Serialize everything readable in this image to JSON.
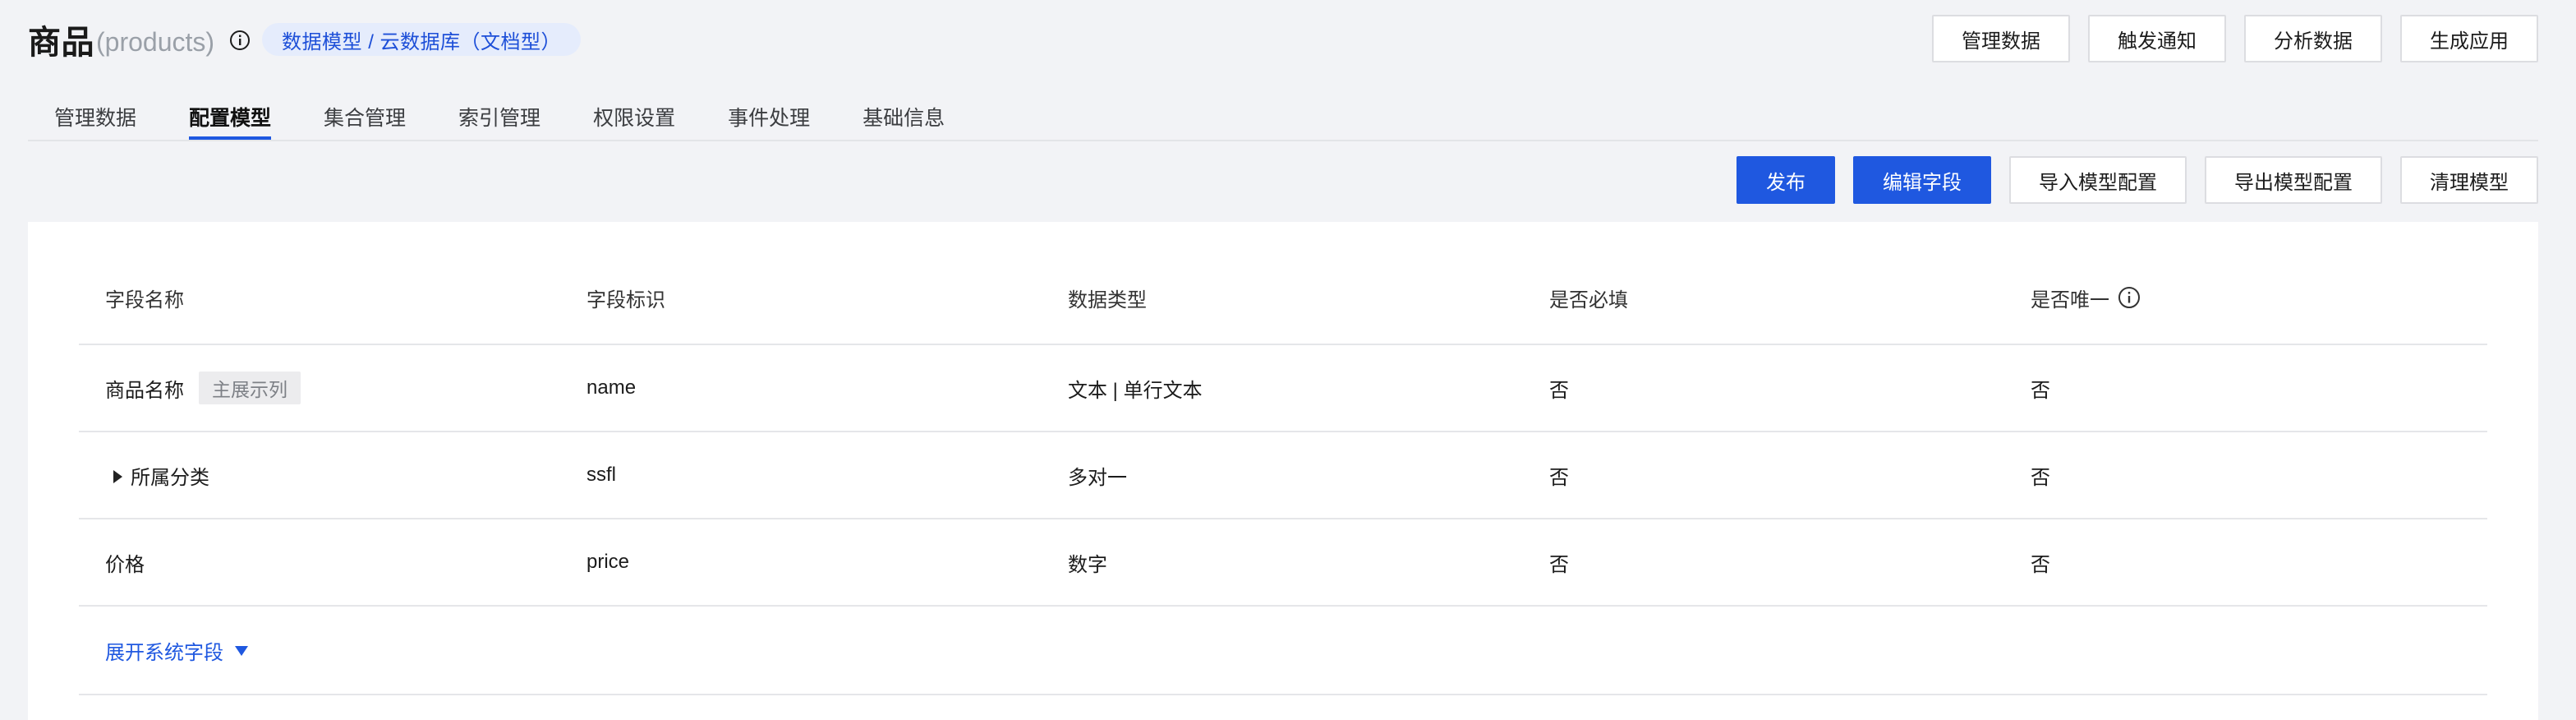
{
  "header": {
    "title": "商品",
    "subtitle": "(products)",
    "info_icon": "info-circle-icon",
    "breadcrumb": "数据模型 / 云数据库（文档型）"
  },
  "top_actions": [
    {
      "label": "管理数据"
    },
    {
      "label": "触发通知"
    },
    {
      "label": "分析数据"
    },
    {
      "label": "生成应用"
    }
  ],
  "tabs": [
    {
      "label": "管理数据",
      "active": false
    },
    {
      "label": "配置模型",
      "active": true
    },
    {
      "label": "集合管理",
      "active": false
    },
    {
      "label": "索引管理",
      "active": false
    },
    {
      "label": "权限设置",
      "active": false
    },
    {
      "label": "事件处理",
      "active": false
    },
    {
      "label": "基础信息",
      "active": false
    }
  ],
  "toolbar": {
    "publish": "发布",
    "edit_fields": "编辑字段",
    "import_config": "导入模型配置",
    "export_config": "导出模型配置",
    "clear_model": "清理模型"
  },
  "table": {
    "columns": [
      "字段名称",
      "字段标识",
      "数据类型",
      "是否必填",
      "是否唯一"
    ],
    "rows": [
      {
        "name": "商品名称",
        "tag": "主展示列",
        "id": "name",
        "type": "文本 | 单行文本",
        "required": "否",
        "unique": "否",
        "expandable": false
      },
      {
        "name": "所属分类",
        "tag": "",
        "id": "ssfl",
        "type": "多对一",
        "required": "否",
        "unique": "否",
        "expandable": true
      },
      {
        "name": "价格",
        "tag": "",
        "id": "price",
        "type": "数字",
        "required": "否",
        "unique": "否",
        "expandable": false
      }
    ],
    "expand_label": "展开系统字段"
  },
  "colors": {
    "primary": "#1f58e0",
    "pill_bg": "#e5ecfc",
    "page_bg": "#f2f3f6"
  }
}
